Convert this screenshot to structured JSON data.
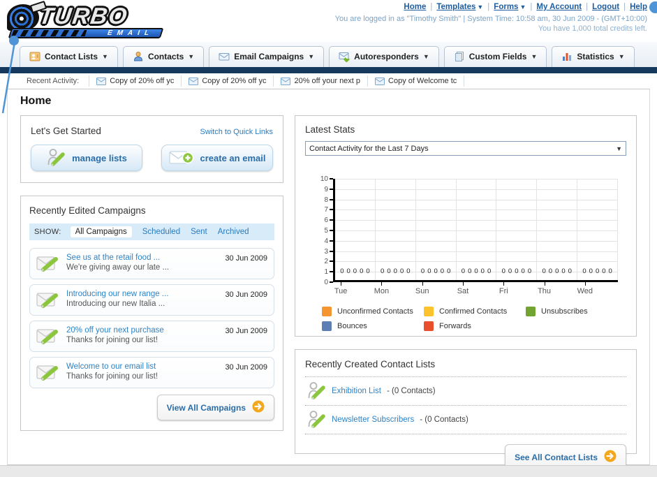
{
  "header": {
    "logo_title": "TURBO",
    "logo_subtitle": "EMAIL",
    "nav_links": [
      {
        "label": "Home",
        "dropdown": false
      },
      {
        "label": "Templates",
        "dropdown": true
      },
      {
        "label": "Forms",
        "dropdown": true
      },
      {
        "label": "My Account",
        "dropdown": false
      },
      {
        "label": "Logout",
        "dropdown": false
      },
      {
        "label": "Help",
        "dropdown": false
      }
    ],
    "login_status": "You are logged in as \"Timothy Smith\" | System Time: 10:58 am, 30 Jun 2009 - (GMT+10:00)",
    "credits": "You have 1,000 total credits left."
  },
  "tabs": [
    {
      "label": "Contact Lists",
      "icon": "contact-lists-icon"
    },
    {
      "label": "Contacts",
      "icon": "contacts-icon"
    },
    {
      "label": "Email Campaigns",
      "icon": "email-campaigns-icon"
    },
    {
      "label": "Autoresponders",
      "icon": "autoresponders-icon"
    },
    {
      "label": "Custom Fields",
      "icon": "custom-fields-icon"
    },
    {
      "label": "Statistics",
      "icon": "statistics-icon"
    }
  ],
  "recent_activity": {
    "label": "Recent Activity:",
    "items": [
      "Copy of 20% off yc",
      "Copy of 20% off yc",
      "20% off your next p",
      "Copy of Welcome tc"
    ]
  },
  "page_title": "Home",
  "get_started": {
    "title": "Let's Get Started",
    "switch_link": "Switch to Quick Links",
    "buttons": [
      {
        "label": "manage lists",
        "icon": "person-pencil-icon"
      },
      {
        "label": "create an email",
        "icon": "envelope-plus-icon"
      }
    ]
  },
  "campaigns": {
    "title": "Recently Edited Campaigns",
    "filter_label": "SHOW:",
    "filters": [
      "All Campaigns",
      "Scheduled",
      "Sent",
      "Archived"
    ],
    "active_filter": "All Campaigns",
    "items": [
      {
        "title": "See us at the retail food ...",
        "subtitle": "We're giving away our late ...",
        "date": "30 Jun 2009"
      },
      {
        "title": "Introducing our new range ...",
        "subtitle": "Introducing our new Italia ...",
        "date": "30 Jun 2009"
      },
      {
        "title": "20% off your next purchase",
        "subtitle": "Thanks for joining our list!",
        "date": "30 Jun 2009"
      },
      {
        "title": "Welcome to our email list",
        "subtitle": "Thanks for joining our list!",
        "date": "30 Jun 2009"
      }
    ],
    "view_all_label": "View All Campaigns"
  },
  "latest_stats": {
    "title": "Latest Stats",
    "dropdown_value": "Contact Activity for the Last 7 Days"
  },
  "chart_data": {
    "type": "bar",
    "title": "Contact Activity for the Last 7 Days",
    "categories": [
      "Tue",
      "Mon",
      "Sun",
      "Sat",
      "Fri",
      "Thu",
      "Wed"
    ],
    "series": [
      {
        "name": "Unconfirmed Contacts",
        "color": "#f49530",
        "values": [
          0,
          0,
          0,
          0,
          0,
          0,
          0
        ]
      },
      {
        "name": "Confirmed Contacts",
        "color": "#fcc32c",
        "values": [
          0,
          0,
          0,
          0,
          0,
          0,
          0
        ]
      },
      {
        "name": "Unsubscribes",
        "color": "#72a431",
        "values": [
          0,
          0,
          0,
          0,
          0,
          0,
          0
        ]
      },
      {
        "name": "Bounces",
        "color": "#5d7eb5",
        "values": [
          0,
          0,
          0,
          0,
          0,
          0,
          0
        ]
      },
      {
        "name": "Forwards",
        "color": "#e94f2c",
        "values": [
          0,
          0,
          0,
          0,
          0,
          0,
          0
        ]
      }
    ],
    "xlabel": "",
    "ylabel": "",
    "ylim": [
      0,
      10
    ],
    "yticks": [
      0,
      1,
      2,
      3,
      4,
      5,
      6,
      7,
      8,
      9,
      10
    ],
    "grid": true,
    "legend_position": "bottom",
    "data_labels_shown": true
  },
  "contact_lists": {
    "title": "Recently Created Contact Lists",
    "items": [
      {
        "name": "Exhibition List",
        "detail": "- (0 Contacts)"
      },
      {
        "name": "Newsletter Subscribers",
        "detail": "- (0 Contacts)"
      }
    ],
    "see_all_label": "See All Contact Lists"
  }
}
